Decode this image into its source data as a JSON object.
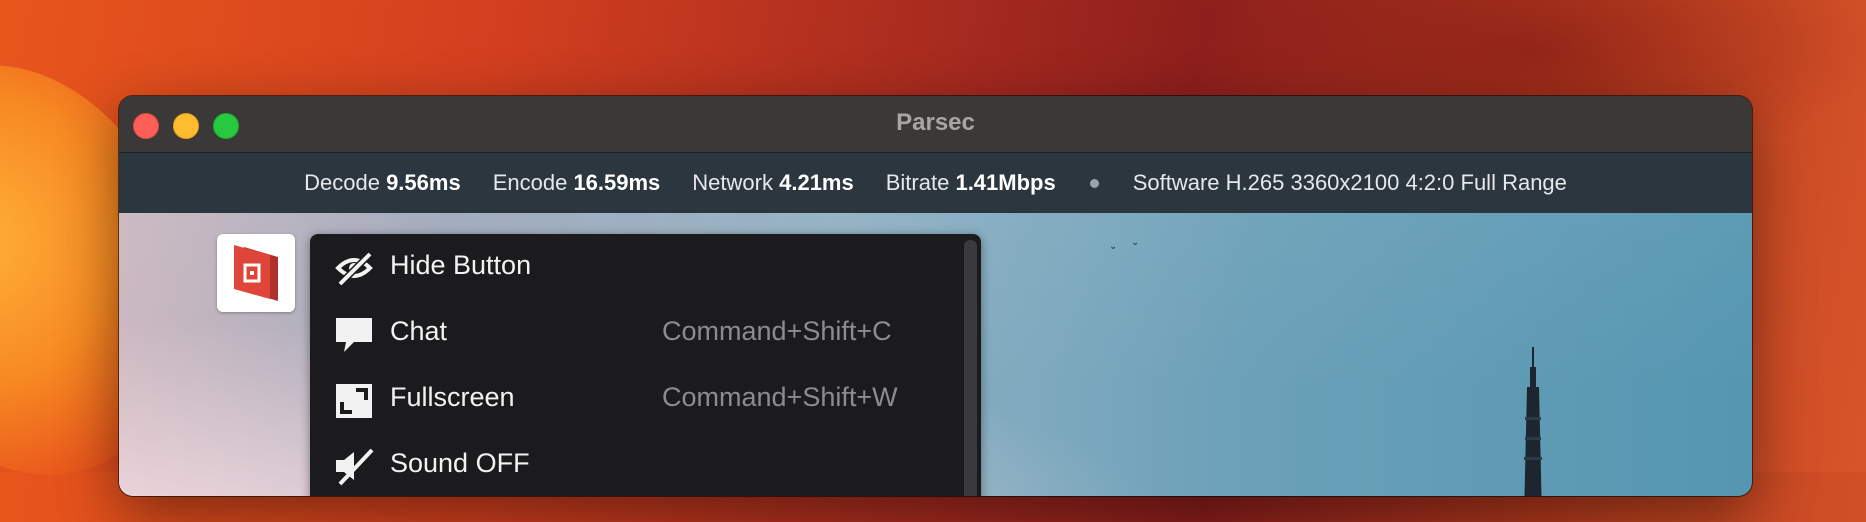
{
  "window": {
    "title": "Parsec"
  },
  "stats": {
    "decode_label": "Decode",
    "decode_value": "9.56ms",
    "encode_label": "Encode",
    "encode_value": "16.59ms",
    "network_label": "Network",
    "network_value": "4.21ms",
    "bitrate_label": "Bitrate",
    "bitrate_value": "1.41Mbps",
    "codec_info": "Software H.265 3360x2100 4:2:0 Full Range"
  },
  "menu": {
    "items": [
      {
        "icon": "eye-slash-icon",
        "label": "Hide Button",
        "shortcut": ""
      },
      {
        "icon": "chat-bubble-icon",
        "label": "Chat",
        "shortcut": "Command+Shift+C"
      },
      {
        "icon": "fullscreen-icon",
        "label": "Fullscreen",
        "shortcut": "Command+Shift+W"
      },
      {
        "icon": "sound-off-icon",
        "label": "Sound OFF",
        "shortcut": ""
      }
    ]
  },
  "colors": {
    "close": "#ff5f57",
    "minimize": "#febc2e",
    "maximize": "#28c840",
    "brand": "#e0453a"
  }
}
